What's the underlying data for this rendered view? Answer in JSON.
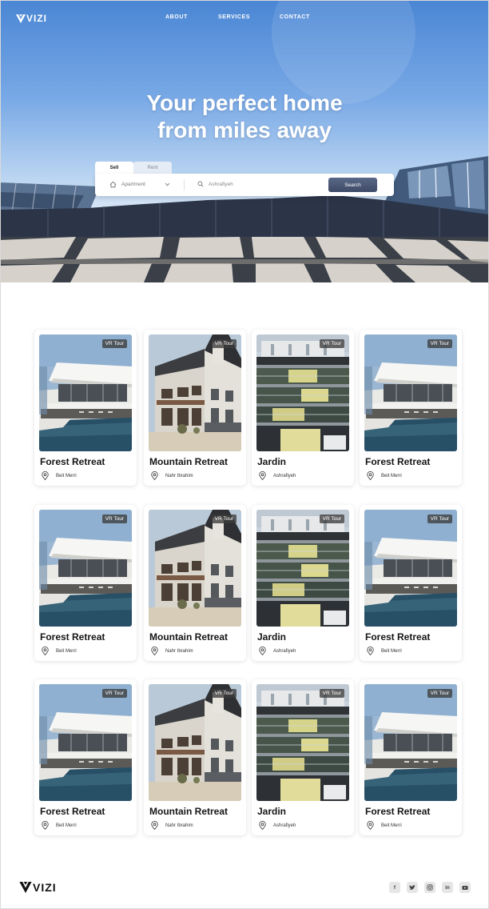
{
  "brand": {
    "name": "VIZI"
  },
  "nav": {
    "links": [
      "ABOUT",
      "SERVICES",
      "CONTACT"
    ]
  },
  "hero": {
    "title_line1": "Your perfect home",
    "title_line2": "from miles away"
  },
  "search": {
    "tabs": [
      "Sell",
      "Rent"
    ],
    "active_tab": "Sell",
    "property_type": "Apartment",
    "location": "Ashrafiyeh",
    "button_label": "Search",
    "icons": [
      "home-icon",
      "chevron-down-icon",
      "search-icon"
    ]
  },
  "colors": {
    "search_button": "#4a5674",
    "sky": "#6fa3e3",
    "vr_badge": "#3c3c3c"
  },
  "listings": [
    {
      "name": "Forest Retreat",
      "location": "Beit Merri",
      "badge": "VR Tour",
      "image": "modern-villa-pool"
    },
    {
      "name": "Mountain Retreat",
      "location": "Nahr Ibrahim",
      "badge": "VR Tour",
      "image": "traditional-house"
    },
    {
      "name": "Jardin",
      "location": "Ashrafiyeh",
      "badge": "VR Tour",
      "image": "glass-apartment-building"
    },
    {
      "name": "Forest Retreat",
      "location": "Beit Merri",
      "badge": "VR Tour",
      "image": "modern-villa-pool"
    },
    {
      "name": "Forest Retreat",
      "location": "Beit Merri",
      "badge": "VR Tour",
      "image": "modern-villa-pool"
    },
    {
      "name": "Mountain Retreat",
      "location": "Nahr Ibrahim",
      "badge": "VR Tour",
      "image": "traditional-house"
    },
    {
      "name": "Jardin",
      "location": "Ashrafiyeh",
      "badge": "VR Tour",
      "image": "glass-apartment-building"
    },
    {
      "name": "Forest Retreat",
      "location": "Beit Merri",
      "badge": "VR Tour",
      "image": "modern-villa-pool"
    },
    {
      "name": "Forest Retreat",
      "location": "Beit Merri",
      "badge": "VR Tour",
      "image": "modern-villa-pool"
    },
    {
      "name": "Mountain Retreat",
      "location": "Nahr Ibrahim",
      "badge": "VR Tour",
      "image": "traditional-house"
    },
    {
      "name": "Jardin",
      "location": "Ashrafiyeh",
      "badge": "VR Tour",
      "image": "glass-apartment-building"
    },
    {
      "name": "Forest Retreat",
      "location": "Beit Merri",
      "badge": "VR Tour",
      "image": "modern-villa-pool"
    }
  ],
  "footer": {
    "social": [
      "facebook-icon",
      "twitter-icon",
      "instagram-icon",
      "linkedin-icon",
      "youtube-icon"
    ]
  }
}
